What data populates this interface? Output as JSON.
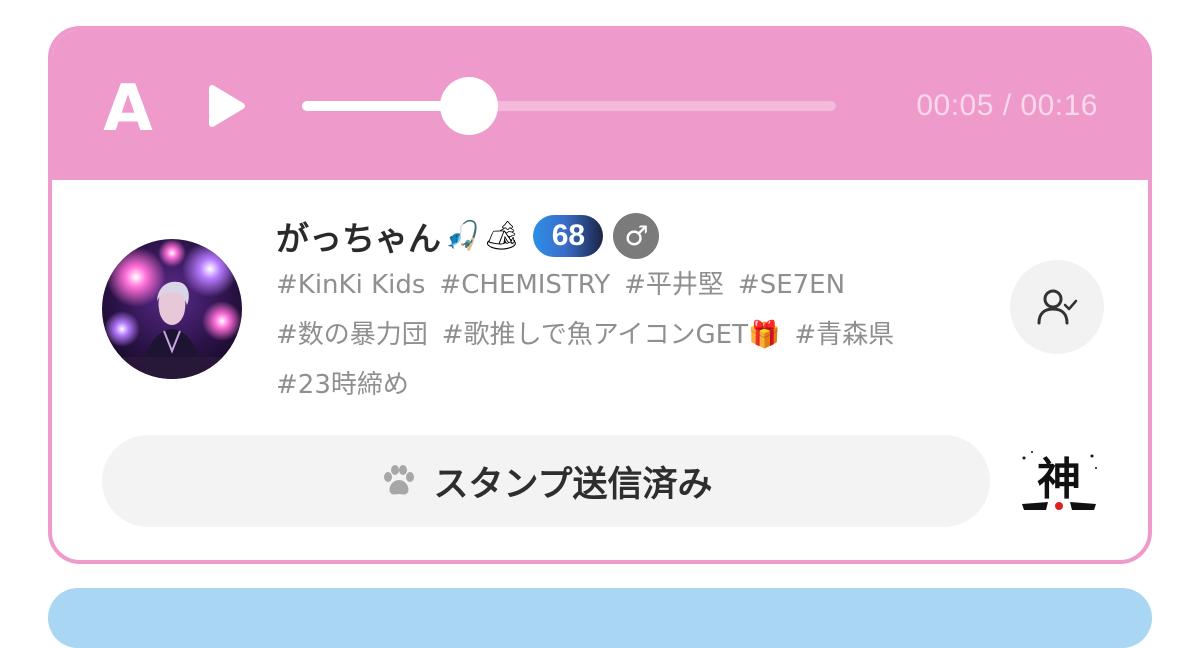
{
  "player": {
    "letter": "A",
    "time_display": "00:05 / 00:16",
    "progress_fraction": 0.3125,
    "play_icon": "play-icon"
  },
  "profile": {
    "name": "がっちゃん",
    "name_emojis": [
      "🎣",
      "🏕"
    ],
    "level": "68",
    "gender_symbol": "♂",
    "tags": [
      "#KinKi Kids",
      "#CHEMISTRY",
      "#平井堅",
      "#SE7EN",
      "#数の暴力団",
      "#歌推しで魚アイコンGET🎁",
      "#青森県",
      "#23時締め"
    ],
    "follow_icon": "user-check-icon"
  },
  "stamp": {
    "label": "スタンプ送信済み",
    "icon": "paw-icon",
    "sent_stamp_text": "神"
  },
  "colors": {
    "accent_pink": "#ee9acb",
    "next_card_blue": "#a9d6f2",
    "tag_gray": "#8f8f8f"
  }
}
